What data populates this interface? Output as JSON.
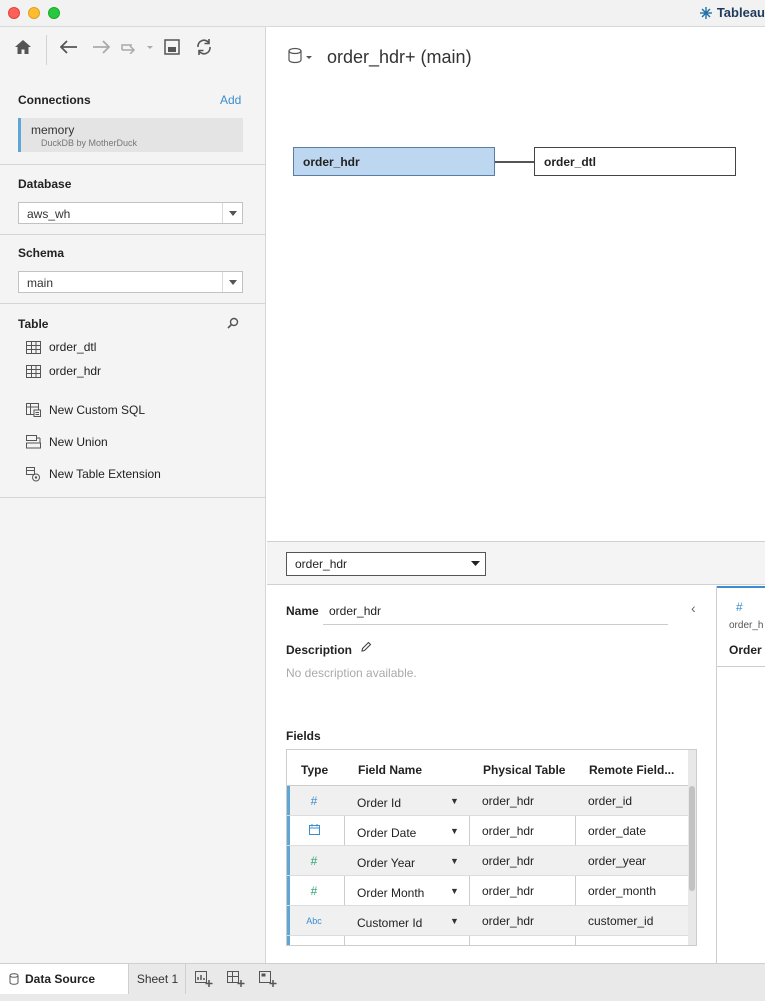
{
  "app": {
    "title": "Tableau"
  },
  "toolbar": {
    "home": "home-icon",
    "back": "back-arrow-icon",
    "forward": "forward-arrow-icon",
    "redo": "redo-icon",
    "save": "save-icon",
    "refresh": "refresh-icon"
  },
  "connections": {
    "label": "Connections",
    "add_label": "Add",
    "items": [
      {
        "name": "memory",
        "subtitle": "DuckDB by MotherDuck"
      }
    ]
  },
  "database": {
    "label": "Database",
    "value": "aws_wh"
  },
  "schema": {
    "label": "Schema",
    "value": "main"
  },
  "table": {
    "label": "Table",
    "items": [
      {
        "name": "order_dtl"
      },
      {
        "name": "order_hdr"
      }
    ],
    "actions": [
      {
        "name": "New Custom SQL",
        "icon": "custom-sql-icon"
      },
      {
        "name": "New Union",
        "icon": "union-icon"
      },
      {
        "name": "New Table Extension",
        "icon": "table-extension-icon"
      }
    ]
  },
  "canvas": {
    "datasource_title": "order_hdr+ (main)",
    "tables": {
      "primary": "order_hdr",
      "secondary": "order_dtl"
    }
  },
  "table_selector": {
    "value": "order_hdr"
  },
  "details": {
    "name_label": "Name",
    "name_value": "order_hdr",
    "description_label": "Description",
    "description_placeholder": "No description available.",
    "fields_label": "Fields",
    "columns": [
      "Type",
      "Field Name",
      "Physical Table",
      "Remote Field..."
    ],
    "rows": [
      {
        "type": "#",
        "type_color": "#3b8dcf",
        "field": "Order Id",
        "physical": "order_hdr",
        "remote": "order_id"
      },
      {
        "type": "date",
        "type_color": "#3b8dcf",
        "field": "Order Date",
        "physical": "order_hdr",
        "remote": "order_date"
      },
      {
        "type": "#",
        "type_color": "#2aa36b",
        "field": "Order Year",
        "physical": "order_hdr",
        "remote": "order_year"
      },
      {
        "type": "#",
        "type_color": "#2aa36b",
        "field": "Order Month",
        "physical": "order_hdr",
        "remote": "order_month"
      },
      {
        "type": "Abc",
        "type_color": "#3b8dcf",
        "field": "Customer Id",
        "physical": "order_hdr",
        "remote": "customer_id"
      }
    ]
  },
  "preview": {
    "type": "#",
    "source": "order_h",
    "field": "Order"
  },
  "tabs": {
    "datasource": "Data Source",
    "sheet": "Sheet 1",
    "icons": [
      "new-worksheet-icon",
      "new-dashboard-icon",
      "new-story-icon"
    ]
  },
  "colors": {
    "accent": "#3b8dcf",
    "selected_table": "#bdd7f0",
    "measure_green": "#2aa36b"
  }
}
